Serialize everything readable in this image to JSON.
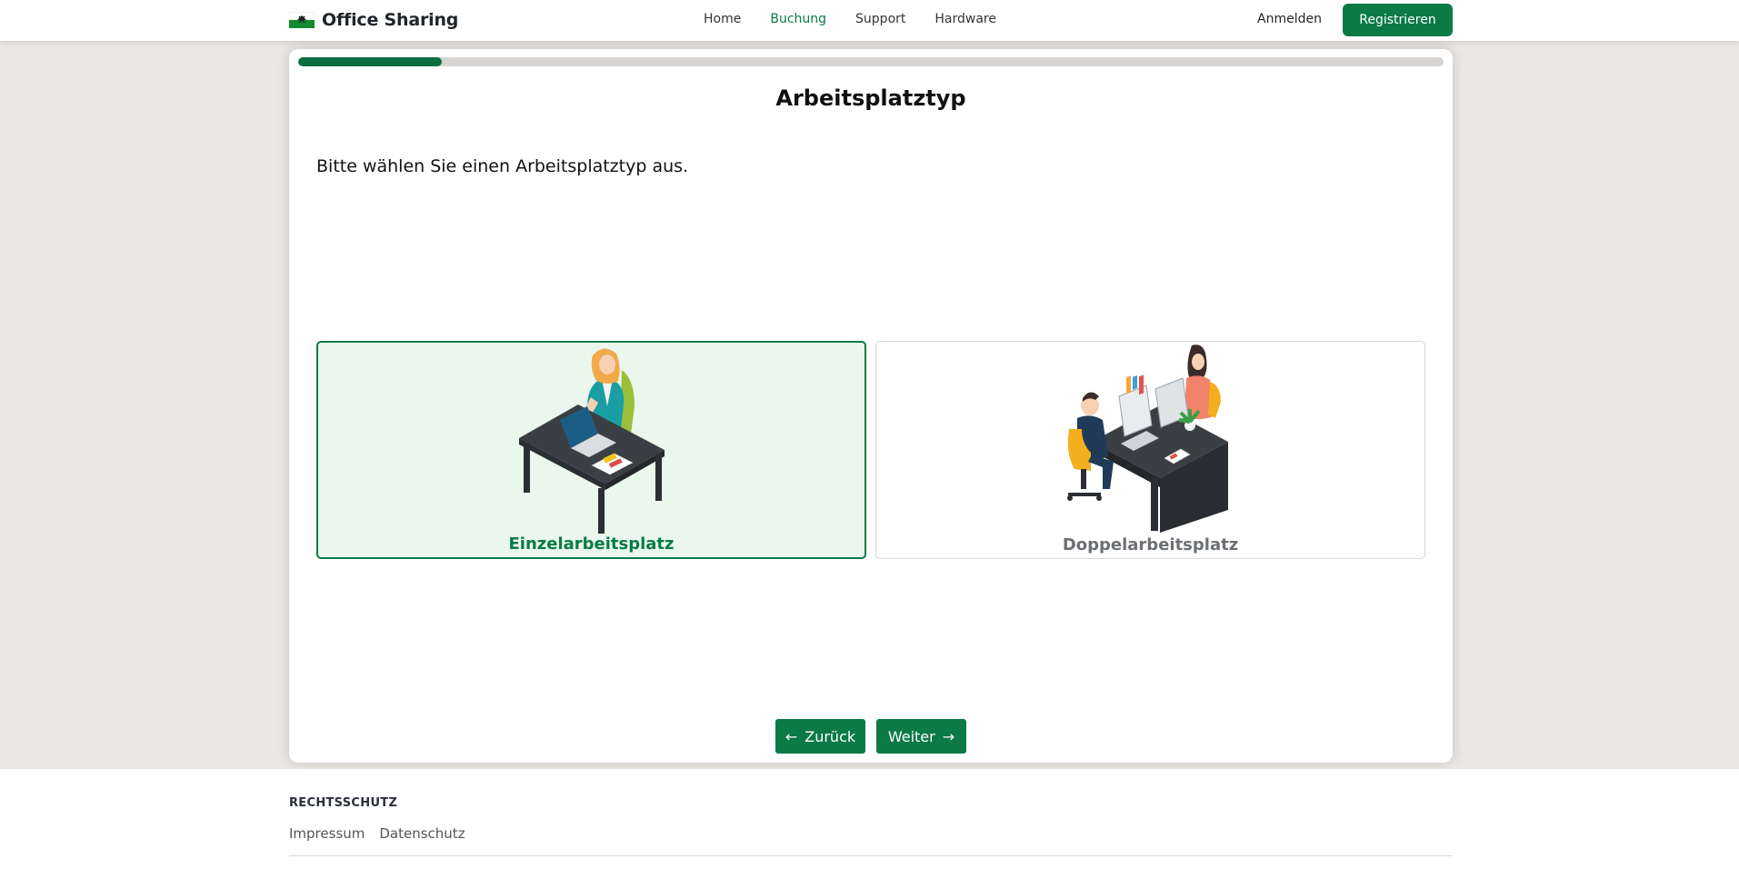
{
  "brand": {
    "name": "Office Sharing",
    "logo_icon": "flag-logo-icon"
  },
  "nav": {
    "links": [
      {
        "label": "Home",
        "active": false
      },
      {
        "label": "Buchung",
        "active": true
      },
      {
        "label": "Support",
        "active": false
      },
      {
        "label": "Hardware",
        "active": false
      }
    ],
    "login_label": "Anmelden",
    "register_label": "Registrieren"
  },
  "booking": {
    "progress_percent": 12.5,
    "title": "Arbeitsplatztyp",
    "instruction": "Bitte wählen Sie einen Arbeitsplatztyp aus.",
    "options": [
      {
        "label": "Einzelarbeitsplatz",
        "selected": true,
        "icon": "single-workspace-illustration"
      },
      {
        "label": "Doppelarbeitsplatz",
        "selected": false,
        "icon": "double-workspace-illustration"
      }
    ],
    "back_label": "Zurück",
    "next_label": "Weiter",
    "back_icon": "arrow-left-icon",
    "next_icon": "arrow-right-icon"
  },
  "footer": {
    "heading": "RECHTSSCHUTZ",
    "links": [
      "Impressum",
      "Datenschutz"
    ]
  },
  "colors": {
    "accent": "#0b7a45",
    "selected_bg": "#e9f7ec",
    "page_bg": "#ebe7e4"
  }
}
